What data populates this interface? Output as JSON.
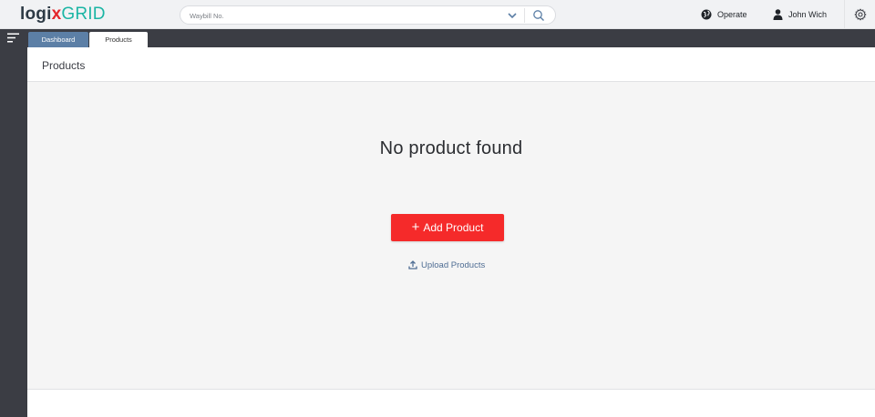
{
  "logo": {
    "part1": "logi",
    "part2": "x",
    "part3": "GRID"
  },
  "search": {
    "placeholder": "Waybill No.",
    "value": ""
  },
  "header": {
    "operate_label": "Operate",
    "user_name": "John Wich"
  },
  "icons": {
    "operate": "globe-icon",
    "user": "user-icon",
    "settings": "gear-icon",
    "menu": "hamburger-icon",
    "dropdown": "chevron-down-icon",
    "search": "search-icon",
    "upload": "upload-icon",
    "add": "plus-icon"
  },
  "tabs": [
    {
      "label": "Dashboard",
      "active": false
    },
    {
      "label": "Products",
      "active": true
    }
  ],
  "page": {
    "title": "Products",
    "empty_message": "No product found",
    "add_button_label": "Add Product",
    "add_button_plus": "+",
    "upload_link_label": "Upload Products"
  },
  "colors": {
    "accent_red": "#f52a2a",
    "tab_active_bg": "#ffffff",
    "tab_inactive_bg": "#5c7fa6",
    "sidebar_bg": "#3b3d44",
    "link_blue": "#4f6d93",
    "logo_teal": "#1bb5a4"
  }
}
